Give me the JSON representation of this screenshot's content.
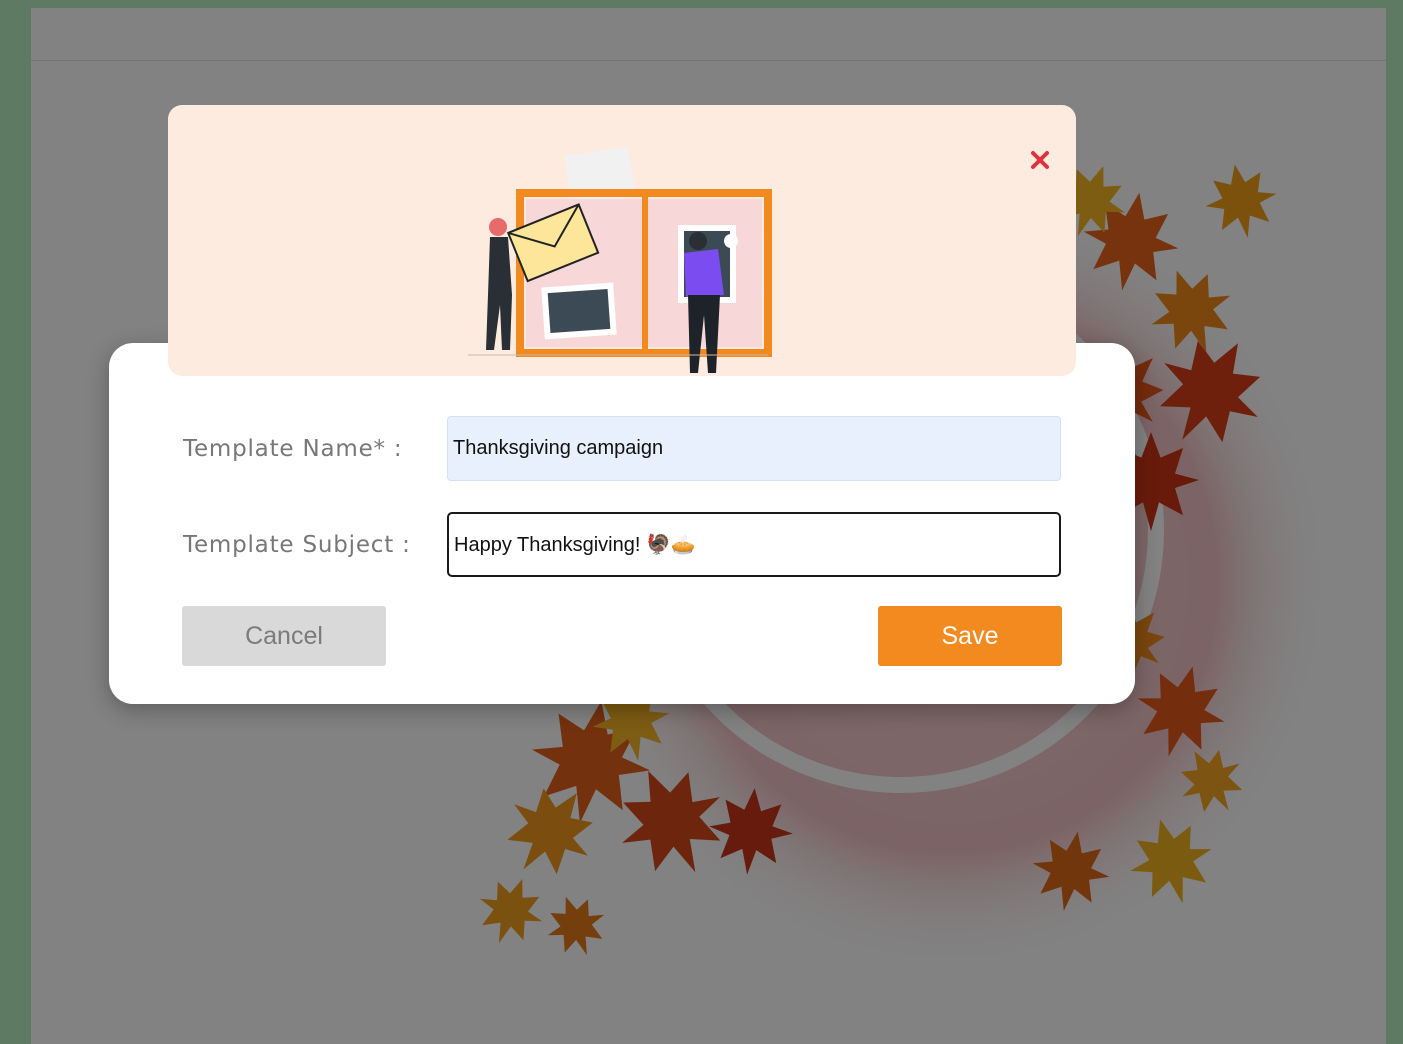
{
  "modal": {
    "close_icon": "close-icon",
    "illustration": "scrapbook-illustration",
    "accent_color": "#f38a20",
    "close_color": "#e0323c"
  },
  "form": {
    "name_label": "Template Name* :",
    "name_value": "Thanksgiving campaign",
    "subject_label": "Template Subject :",
    "subject_value": "Happy Thanksgiving! 🦃🥧"
  },
  "actions": {
    "cancel_label": "Cancel",
    "save_label": "Save"
  },
  "background": {
    "artwork": "autumn-maple-leaf-wreath"
  }
}
